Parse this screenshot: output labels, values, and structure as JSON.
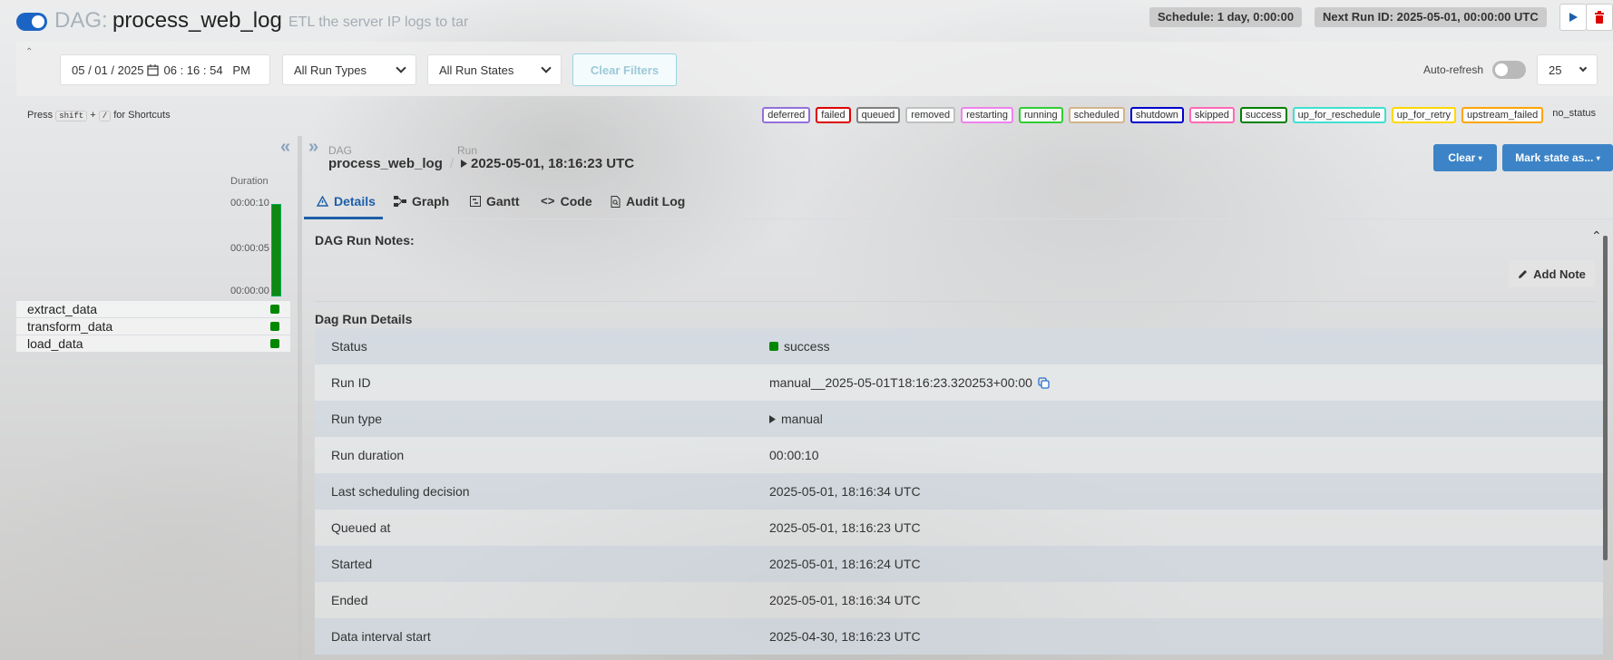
{
  "header": {
    "dag_prefix": "DAG:",
    "dag_name": "process_web_log",
    "description": "ETL the server IP logs to tar",
    "schedule": "Schedule: 1 day, 0:00:00",
    "next_run": "Next Run ID: 2025-05-01, 00:00:00 UTC"
  },
  "filters": {
    "date": "05 / 01 / 2025",
    "time": "06 : 16 : 54   PM",
    "run_types": "All Run Types",
    "run_states": "All Run States",
    "clear_filters": "Clear Filters",
    "auto_refresh": "Auto-refresh",
    "page_size": "25"
  },
  "shortcuts": {
    "press": "Press",
    "shift": "shift",
    "plus": "+",
    "slash": "/",
    "for": "for Shortcuts"
  },
  "legend": [
    {
      "label": "deferred",
      "color": "#9370db"
    },
    {
      "label": "failed",
      "color": "#dd0000"
    },
    {
      "label": "queued",
      "color": "#808080"
    },
    {
      "label": "removed",
      "color": "#c0c0c0"
    },
    {
      "label": "restarting",
      "color": "#ee82ee"
    },
    {
      "label": "running",
      "color": "#32cd32"
    },
    {
      "label": "scheduled",
      "color": "#d2b48c"
    },
    {
      "label": "shutdown",
      "color": "#0000cd"
    },
    {
      "label": "skipped",
      "color": "#ff69b4"
    },
    {
      "label": "success",
      "color": "#008000"
    },
    {
      "label": "up_for_reschedule",
      "color": "#40e0d0"
    },
    {
      "label": "up_for_retry",
      "color": "#ffd700"
    },
    {
      "label": "upstream_failed",
      "color": "#ffa500"
    }
  ],
  "legend_no_status": "no_status",
  "grid": {
    "duration_label": "Duration",
    "ticks": [
      "00:00:10",
      "00:00:05",
      "00:00:00"
    ],
    "tasks": [
      "extract_data",
      "transform_data",
      "load_data"
    ]
  },
  "breadcrumb": {
    "dag_label": "DAG",
    "dag_value": "process_web_log",
    "run_label": "Run",
    "run_value": "2025-05-01, 18:16:23 UTC"
  },
  "actions": {
    "clear": "Clear",
    "mark_state": "Mark state as..."
  },
  "tabs": [
    "Details",
    "Graph",
    "Gantt",
    "Code",
    "Audit Log"
  ],
  "notes": {
    "title": "DAG Run Notes:",
    "add_note": "Add Note"
  },
  "details": {
    "title": "Dag Run Details",
    "rows": [
      {
        "key": "Status",
        "value": "success"
      },
      {
        "key": "Run ID",
        "value": "manual__2025-05-01T18:16:23.320253+00:00"
      },
      {
        "key": "Run type",
        "value": "manual"
      },
      {
        "key": "Run duration",
        "value": "00:00:10"
      },
      {
        "key": "Last scheduling decision",
        "value": "2025-05-01, 18:16:34 UTC"
      },
      {
        "key": "Queued at",
        "value": "2025-05-01, 18:16:23 UTC"
      },
      {
        "key": "Started",
        "value": "2025-05-01, 18:16:24 UTC"
      },
      {
        "key": "Ended",
        "value": "2025-05-01, 18:16:34 UTC"
      },
      {
        "key": "Data interval start",
        "value": "2025-04-30, 18:16:23 UTC"
      }
    ]
  }
}
